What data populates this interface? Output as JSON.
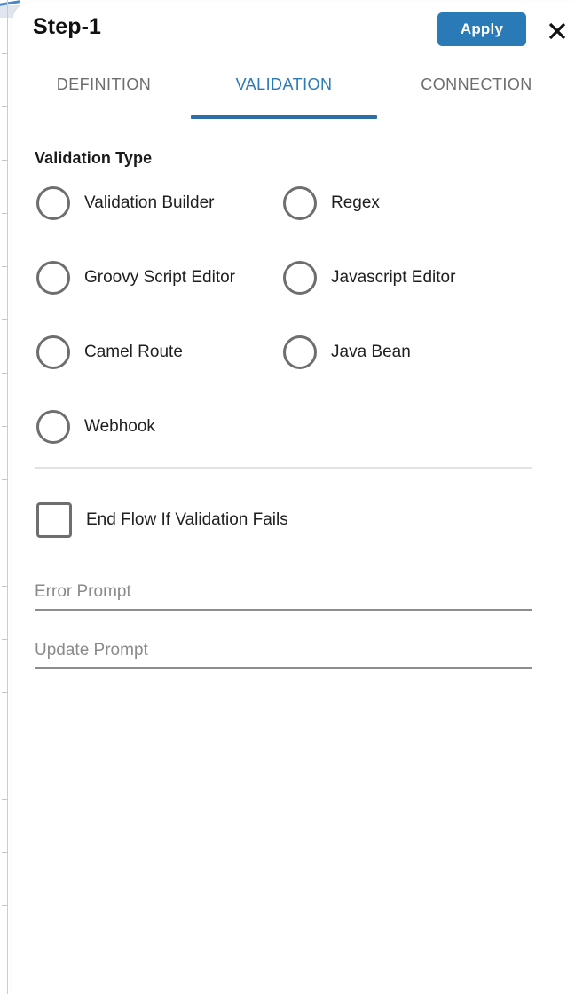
{
  "window": {
    "title": "Step-1"
  },
  "header": {
    "apply_label": "Apply",
    "close_icon": "close-x-icon",
    "accent_color": "#2b7ab8"
  },
  "tabs": [
    {
      "label": "DEFINITION",
      "active": false
    },
    {
      "label": "VALIDATION",
      "active": true
    },
    {
      "label": "CONNECTION",
      "active": false
    }
  ],
  "validation": {
    "section_title": "Validation Type",
    "options": [
      {
        "label": "Validation Builder",
        "selected": false,
        "column": "left",
        "row": 0
      },
      {
        "label": "Regex",
        "selected": false,
        "column": "right",
        "row": 0
      },
      {
        "label": "Groovy Script Editor",
        "selected": false,
        "column": "left",
        "row": 1
      },
      {
        "label": "Javascript Editor",
        "selected": false,
        "column": "right",
        "row": 1
      },
      {
        "label": "Camel Route",
        "selected": false,
        "column": "left",
        "row": 2
      },
      {
        "label": "Java Bean",
        "selected": false,
        "column": "right",
        "row": 2
      },
      {
        "label": "Webhook",
        "selected": false,
        "column": "left",
        "row": 3
      }
    ],
    "end_flow_checkbox": {
      "label": "End Flow If Validation Fails",
      "checked": false
    },
    "fields": [
      {
        "placeholder": "Error Prompt",
        "value": ""
      },
      {
        "placeholder": "Update Prompt",
        "value": ""
      }
    ]
  }
}
